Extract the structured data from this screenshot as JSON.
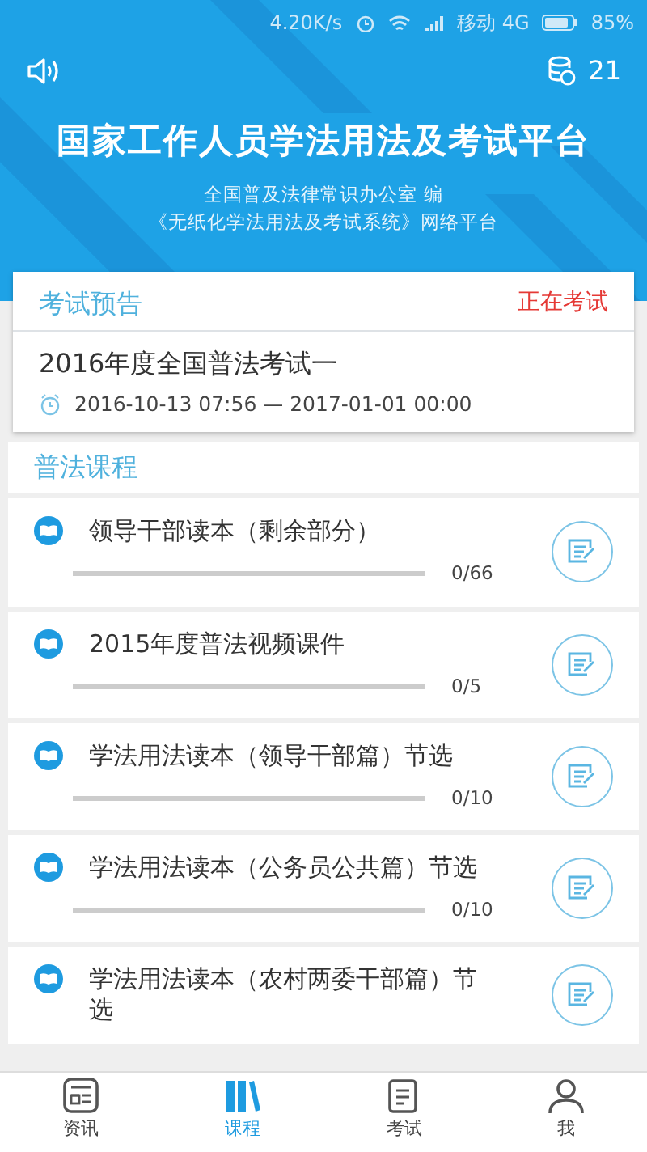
{
  "status_bar": {
    "speed": "4.20K/s",
    "carrier": "移动 4G",
    "battery": "85%"
  },
  "header": {
    "points": "21",
    "title": "国家工作人员学法用法及考试平台",
    "subtitle_lines": [
      "全国普及法律常识办公室 编",
      "《无纸化学法用法及考试系统》网络平台"
    ]
  },
  "exam_notice": {
    "heading": "考试预告",
    "status": "正在考试",
    "exam_title": "2016年度全国普法考试一",
    "time_range": "2016-10-13 07:56  —  2017-01-01 00:00"
  },
  "courses": {
    "heading": "普法课程",
    "items": [
      {
        "title": "领导干部读本（剩余部分）",
        "level": 0,
        "reading": "0/66"
      },
      {
        "title": "2015年度普法视频课件",
        "level": 0,
        "reading": "0/5"
      },
      {
        "title": "学法用法读本（领导干部篇）节选",
        "level": 0,
        "reading": "0/10"
      },
      {
        "title": "学法用法读本（公务员公共篇）节选",
        "level": 0,
        "reading": "0/10"
      },
      {
        "title": "学法用法读本（农村两委干部篇）节选"
      }
    ]
  },
  "tab_bar": [
    {
      "label": "资讯",
      "kind": "news",
      "selected": false
    },
    {
      "label": "课程",
      "kind": "courses",
      "selected": true
    },
    {
      "label": "考试",
      "kind": "exam",
      "selected": false
    },
    {
      "label": "我",
      "kind": "me",
      "selected": false
    }
  ]
}
